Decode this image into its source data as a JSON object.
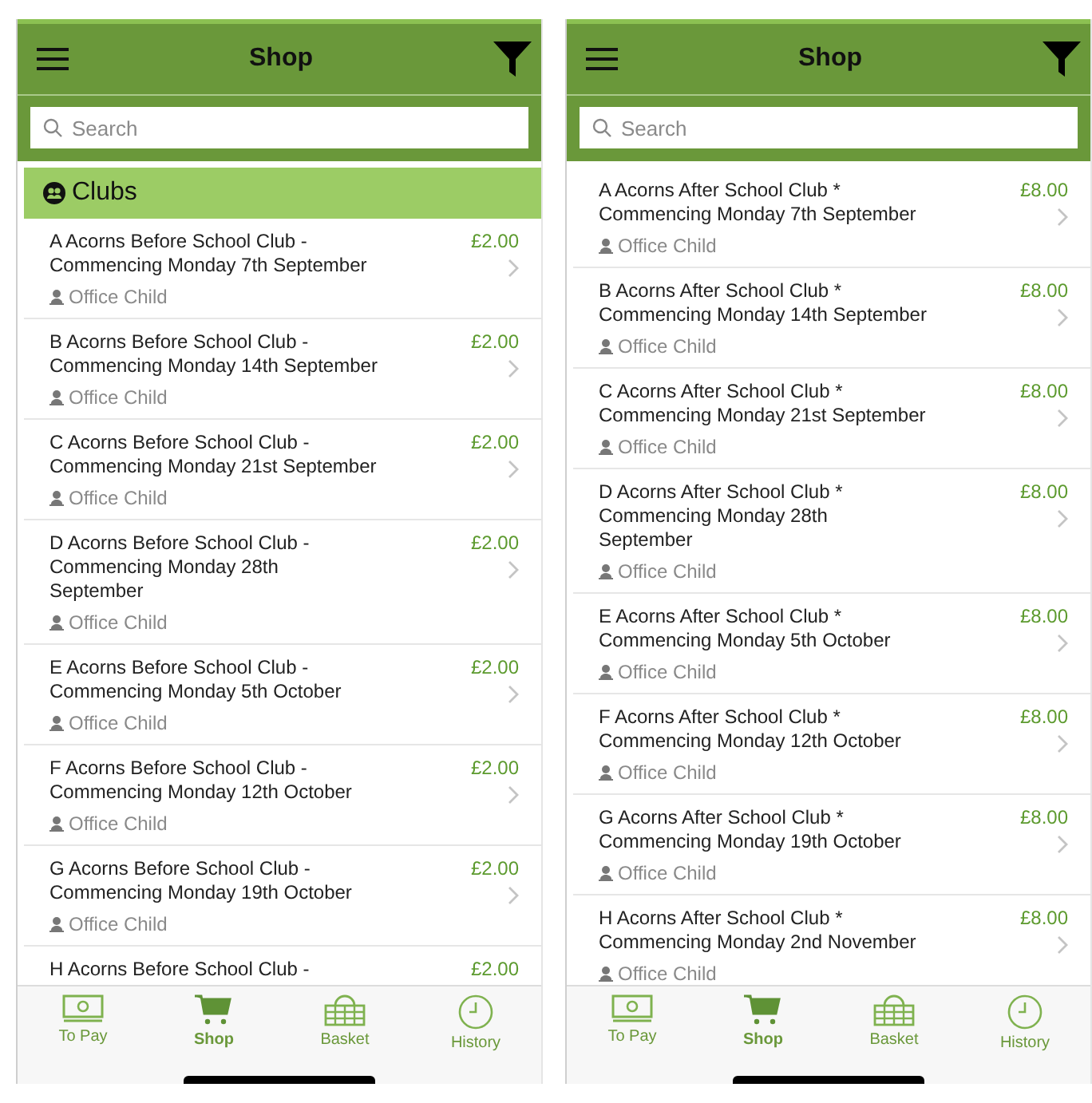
{
  "phones": [
    {
      "title": "Shop",
      "search": {
        "placeholder": "Search"
      },
      "section": "Clubs",
      "items": [
        {
          "title": "A Acorns Before School Club -\nCommencing Monday 7th September",
          "price": "£2.00",
          "child": "Office Child"
        },
        {
          "title": "B Acorns Before School Club -\nCommencing Monday 14th September",
          "price": "£2.00",
          "child": "Office Child"
        },
        {
          "title": "C Acorns Before School Club -\nCommencing Monday 21st September",
          "price": "£2.00",
          "child": "Office Child"
        },
        {
          "title": "D Acorns Before School Club -\nCommencing Monday 28th\nSeptember",
          "price": "£2.00",
          "child": "Office Child"
        },
        {
          "title": "E Acorns Before School Club -\nCommencing Monday 5th October",
          "price": "£2.00",
          "child": "Office Child"
        },
        {
          "title": "F Acorns Before School Club -\nCommencing Monday 12th October",
          "price": "£2.00",
          "child": "Office Child"
        },
        {
          "title": "G Acorns Before School Club -\nCommencing Monday 19th October",
          "price": "£2.00",
          "child": "Office Child"
        },
        {
          "title": "H Acorns Before School Club -",
          "price": "£2.00"
        }
      ],
      "tabs": [
        {
          "label": "To Pay",
          "kind": "money",
          "selected": false
        },
        {
          "label": "Shop",
          "kind": "cart",
          "selected": true
        },
        {
          "label": "Basket",
          "kind": "basket",
          "selected": false
        },
        {
          "label": "History",
          "kind": "clock",
          "selected": false
        }
      ]
    },
    {
      "title": "Shop",
      "search": {
        "placeholder": "Search"
      },
      "items": [
        {
          "title": "A Acorns After School Club *\nCommencing Monday 7th September",
          "price": "£8.00",
          "child": "Office Child"
        },
        {
          "title": "B Acorns After School Club *\nCommencing Monday 14th September",
          "price": "£8.00",
          "child": "Office Child"
        },
        {
          "title": "C Acorns After School Club *\nCommencing Monday 21st September",
          "price": "£8.00",
          "child": "Office Child"
        },
        {
          "title": "D Acorns After School Club *\nCommencing Monday 28th\nSeptember",
          "price": "£8.00",
          "child": "Office Child"
        },
        {
          "title": "E Acorns After School Club *\nCommencing Monday 5th October",
          "price": "£8.00",
          "child": "Office Child"
        },
        {
          "title": "F Acorns After School Club *\nCommencing Monday 12th October",
          "price": "£8.00",
          "child": "Office Child"
        },
        {
          "title": "G Acorns After School Club *\nCommencing Monday 19th October",
          "price": "£8.00",
          "child": "Office Child"
        },
        {
          "title": "H Acorns After School Club *\nCommencing Monday 2nd November",
          "price": "£8.00",
          "child": "Office Child"
        }
      ],
      "tabs": [
        {
          "label": "To Pay",
          "kind": "money",
          "selected": false
        },
        {
          "label": "Shop",
          "kind": "cart",
          "selected": true
        },
        {
          "label": "Basket",
          "kind": "basket",
          "selected": false
        },
        {
          "label": "History",
          "kind": "clock",
          "selected": false
        }
      ]
    }
  ]
}
